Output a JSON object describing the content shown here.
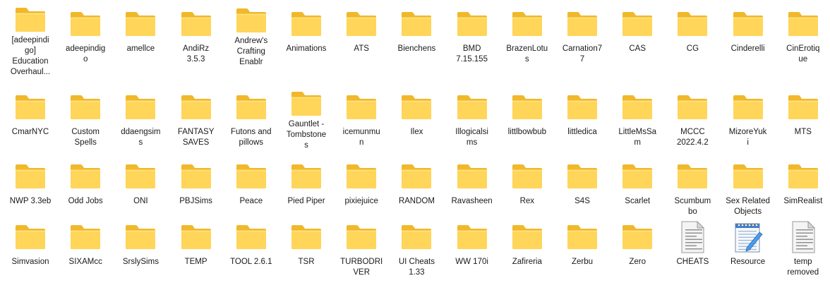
{
  "items": [
    {
      "label": "[adeepindigo] Education Overhaul...",
      "icon": "folder-icon",
      "type": "folder",
      "label_html_lines": [
        "[adeepindi",
        "go]",
        "Education",
        "Overhaul..."
      ]
    },
    {
      "label": "adeepindigo",
      "icon": "folder-icon",
      "type": "folder",
      "label_html_lines": [
        "adeepindig",
        "o"
      ]
    },
    {
      "label": "amellce",
      "icon": "folder-icon",
      "type": "folder",
      "label_html_lines": [
        "amellce"
      ]
    },
    {
      "label": "AndiRz 3.5.3",
      "icon": "folder-icon",
      "type": "folder",
      "label_html_lines": [
        "AndiRz",
        "3.5.3"
      ]
    },
    {
      "label": "Andrew's Crafting Enablr",
      "icon": "folder-icon",
      "type": "folder",
      "label_html_lines": [
        "Andrew's",
        "Crafting",
        "Enablr"
      ]
    },
    {
      "label": "Animations",
      "icon": "folder-icon",
      "type": "folder",
      "label_html_lines": [
        "Animations"
      ]
    },
    {
      "label": "ATS",
      "icon": "folder-icon",
      "type": "folder",
      "label_html_lines": [
        "ATS"
      ]
    },
    {
      "label": "Bienchens",
      "icon": "folder-icon",
      "type": "folder",
      "label_html_lines": [
        "Bienchens"
      ]
    },
    {
      "label": "BMD 7.15.155",
      "icon": "folder-icon",
      "type": "folder",
      "label_html_lines": [
        "BMD",
        "7.15.155"
      ]
    },
    {
      "label": "BrazenLotus",
      "icon": "folder-icon",
      "type": "folder",
      "label_html_lines": [
        "BrazenLotu",
        "s"
      ]
    },
    {
      "label": "Carnation77",
      "icon": "folder-icon",
      "type": "folder",
      "label_html_lines": [
        "Carnation7",
        "7"
      ]
    },
    {
      "label": "CAS",
      "icon": "folder-icon",
      "type": "folder",
      "label_html_lines": [
        "CAS"
      ]
    },
    {
      "label": "CG",
      "icon": "folder-icon",
      "type": "folder",
      "label_html_lines": [
        "CG"
      ]
    },
    {
      "label": "Cinderelli",
      "icon": "folder-icon",
      "type": "folder",
      "label_html_lines": [
        "Cinderelli"
      ]
    },
    {
      "label": "CinErotique",
      "icon": "folder-icon",
      "type": "folder",
      "label_html_lines": [
        "CinErotiq",
        "ue"
      ]
    },
    {
      "label": "CmarNYC",
      "icon": "folder-icon",
      "type": "folder",
      "label_html_lines": [
        "CmarNYC"
      ]
    },
    {
      "label": "Custom Spells",
      "icon": "folder-icon",
      "type": "folder",
      "label_html_lines": [
        "Custom",
        "Spells"
      ]
    },
    {
      "label": "ddaengsims",
      "icon": "folder-icon",
      "type": "folder",
      "label_html_lines": [
        "ddaengsim",
        "s"
      ]
    },
    {
      "label": "FANTASY SAVES",
      "icon": "folder-icon",
      "type": "folder",
      "label_html_lines": [
        "FANTASY",
        "SAVES"
      ]
    },
    {
      "label": "Futons and pillows",
      "icon": "folder-icon",
      "type": "folder",
      "label_html_lines": [
        "Futons and",
        "pillows"
      ]
    },
    {
      "label": "Gauntlet - Tombstones",
      "icon": "folder-icon",
      "type": "folder",
      "label_html_lines": [
        "Gauntlet -",
        "Tombstone",
        "s"
      ]
    },
    {
      "label": "icemunmun",
      "icon": "folder-icon",
      "type": "folder",
      "label_html_lines": [
        "icemunmu",
        "n"
      ]
    },
    {
      "label": "Ilex",
      "icon": "folder-icon",
      "type": "folder",
      "label_html_lines": [
        "Ilex"
      ]
    },
    {
      "label": "Illogicalsims",
      "icon": "folder-icon",
      "type": "folder",
      "label_html_lines": [
        "Illogicalsi",
        "ms"
      ]
    },
    {
      "label": "littlbowbub",
      "icon": "folder-icon",
      "type": "folder",
      "label_html_lines": [
        "littlbowbub"
      ]
    },
    {
      "label": "littledica",
      "icon": "folder-icon",
      "type": "folder",
      "label_html_lines": [
        "littledica"
      ]
    },
    {
      "label": "LittleMsSam",
      "icon": "folder-icon",
      "type": "folder",
      "label_html_lines": [
        "LittleMsSa",
        "m"
      ]
    },
    {
      "label": "MCCC 2022.4.2",
      "icon": "folder-icon",
      "type": "folder",
      "label_html_lines": [
        "MCCC",
        "2022.4.2"
      ]
    },
    {
      "label": "MizoreYuki",
      "icon": "folder-icon",
      "type": "folder",
      "label_html_lines": [
        "MizoreYuk",
        "i"
      ]
    },
    {
      "label": "MTS",
      "icon": "folder-icon",
      "type": "folder",
      "label_html_lines": [
        "MTS"
      ]
    },
    {
      "label": "NWP 3.3eb",
      "icon": "folder-icon",
      "type": "folder",
      "label_html_lines": [
        "NWP 3.3eb"
      ]
    },
    {
      "label": "Odd Jobs",
      "icon": "folder-icon",
      "type": "folder",
      "label_html_lines": [
        "Odd Jobs"
      ]
    },
    {
      "label": "ONI",
      "icon": "folder-icon",
      "type": "folder",
      "label_html_lines": [
        "ONI"
      ]
    },
    {
      "label": "PBJSims",
      "icon": "folder-icon",
      "type": "folder",
      "label_html_lines": [
        "PBJSims"
      ]
    },
    {
      "label": "Peace",
      "icon": "folder-icon",
      "type": "folder",
      "label_html_lines": [
        "Peace"
      ]
    },
    {
      "label": "Pied Piper",
      "icon": "folder-icon",
      "type": "folder",
      "label_html_lines": [
        "Pied Piper"
      ]
    },
    {
      "label": "pixiejuice",
      "icon": "folder-icon",
      "type": "folder",
      "label_html_lines": [
        "pixiejuice"
      ]
    },
    {
      "label": "RANDOM",
      "icon": "folder-icon",
      "type": "folder",
      "label_html_lines": [
        "RANDOM"
      ]
    },
    {
      "label": "Ravasheen",
      "icon": "folder-icon",
      "type": "folder",
      "label_html_lines": [
        "Ravasheen"
      ]
    },
    {
      "label": "Rex",
      "icon": "folder-icon",
      "type": "folder",
      "label_html_lines": [
        "Rex"
      ]
    },
    {
      "label": "S4S",
      "icon": "folder-icon",
      "type": "folder",
      "label_html_lines": [
        "S4S"
      ]
    },
    {
      "label": "Scarlet",
      "icon": "folder-icon",
      "type": "folder",
      "label_html_lines": [
        "Scarlet"
      ]
    },
    {
      "label": "Scumbumbo",
      "icon": "folder-icon",
      "type": "folder",
      "label_html_lines": [
        "Scumbum",
        "bo"
      ]
    },
    {
      "label": "Sex Related Objects",
      "icon": "folder-icon",
      "type": "folder",
      "label_html_lines": [
        "Sex Related",
        "Objects"
      ]
    },
    {
      "label": "SimRealist",
      "icon": "folder-icon",
      "type": "folder",
      "label_html_lines": [
        "SimRealist"
      ]
    },
    {
      "label": "Simvasion",
      "icon": "folder-icon",
      "type": "folder",
      "label_html_lines": [
        "Simvasion"
      ]
    },
    {
      "label": "SIXAMcc",
      "icon": "folder-icon",
      "type": "folder",
      "label_html_lines": [
        "SIXAMcc"
      ]
    },
    {
      "label": "SrslySims",
      "icon": "folder-icon",
      "type": "folder",
      "label_html_lines": [
        "SrslySims"
      ]
    },
    {
      "label": "TEMP",
      "icon": "folder-icon",
      "type": "folder",
      "label_html_lines": [
        "TEMP"
      ]
    },
    {
      "label": "TOOL 2.6.1",
      "icon": "folder-icon",
      "type": "folder",
      "label_html_lines": [
        "TOOL 2.6.1"
      ]
    },
    {
      "label": "TSR",
      "icon": "folder-icon",
      "type": "folder",
      "label_html_lines": [
        "TSR"
      ]
    },
    {
      "label": "TURBODRIVER",
      "icon": "folder-icon",
      "type": "folder",
      "label_html_lines": [
        "TURBODRI",
        "VER"
      ]
    },
    {
      "label": "UI Cheats 1.33",
      "icon": "folder-icon",
      "type": "folder",
      "label_html_lines": [
        "UI Cheats",
        "1.33"
      ]
    },
    {
      "label": "WW 170i",
      "icon": "folder-icon",
      "type": "folder",
      "label_html_lines": [
        "WW 170i"
      ]
    },
    {
      "label": "Zafireria",
      "icon": "folder-icon",
      "type": "folder",
      "label_html_lines": [
        "Zafireria"
      ]
    },
    {
      "label": "Zerbu",
      "icon": "folder-icon",
      "type": "folder",
      "label_html_lines": [
        "Zerbu"
      ]
    },
    {
      "label": "Zero",
      "icon": "folder-icon",
      "type": "folder",
      "label_html_lines": [
        "Zero"
      ]
    },
    {
      "label": "CHEATS",
      "icon": "text-document-icon",
      "type": "text",
      "label_html_lines": [
        "CHEATS"
      ]
    },
    {
      "label": "Resource",
      "icon": "notepad-icon",
      "type": "notepad",
      "label_html_lines": [
        "Resource"
      ]
    },
    {
      "label": "temp removed",
      "icon": "text-document-icon",
      "type": "text",
      "label_html_lines": [
        "temp",
        "removed"
      ]
    }
  ],
  "colors": {
    "folder_back": "#f0b82a",
    "folder_front": "#ffd55a",
    "folder_highlight": "#ffe48a",
    "doc_body": "#f4f4f4",
    "doc_lines": "#8a8a8a",
    "notepad_blue": "#3a7fd0",
    "label_text": "#1a1a1a"
  }
}
